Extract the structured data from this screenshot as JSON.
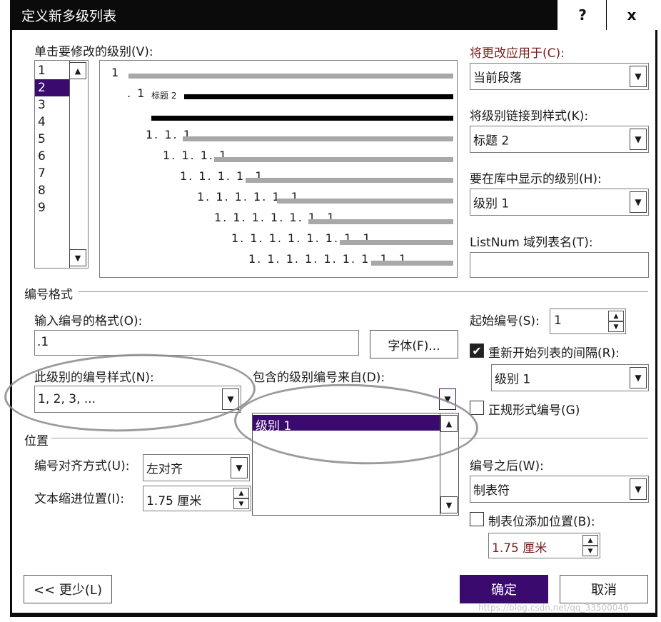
{
  "window": {
    "title": "定义新多级列表",
    "help_label": "?",
    "close_label": "x"
  },
  "levels": {
    "label": "单击要修改的级别(V):",
    "items": [
      "1",
      "2",
      "3",
      "4",
      "5",
      "6",
      "7",
      "8",
      "9"
    ],
    "selected": "2"
  },
  "preview": {
    "rows": [
      "1",
      ". 1",
      "1. 1. 1",
      "1. 1. 1. 1",
      "1. 1. 1. 1. 1",
      "1. 1. 1. 1. 1. 1",
      "1. 1. 1. 1. 1. 1. 1",
      "1. 1. 1. 1. 1. 1. 1. 1",
      "1. 1. 1. 1. 1. 1. 1. 1. 1"
    ],
    "heading_label": "标题 2"
  },
  "right": {
    "apply_label": "将更改应用于(C):",
    "apply_value": "当前段落",
    "link_label": "将级别链接到样式(K):",
    "link_value": "标题 2",
    "gallery_label": "要在库中显示的级别(H):",
    "gallery_value": "级别 1",
    "listnum_label": "ListNum 域列表名(T):",
    "listnum_value": ""
  },
  "number_format": {
    "section_label": "编号格式",
    "format_label": "输入编号的格式(O):",
    "format_value": ".1",
    "font_button": "字体(F)...",
    "style_label": "此级别的编号样式(N):",
    "style_value": "1, 2, 3, ...",
    "include_label": "包含的级别编号来自(D):",
    "include_dropdown_items": [
      "级别 1"
    ],
    "start_label": "起始编号(S):",
    "start_value": "1",
    "restart_label": "重新开始列表的间隔(R):",
    "restart_checked": true,
    "restart_value": "级别 1",
    "legal_label": "正规形式编号(G)",
    "legal_checked": false
  },
  "position": {
    "section_label": "位置",
    "align_label": "编号对齐方式(U):",
    "align_value": "左对齐",
    "indent_label": "文本缩进位置(I):",
    "indent_value": "1.75 厘米",
    "after_label": "编号之后(W):",
    "after_value": "制表符",
    "tab_label": "制表位添加位置(B):",
    "tab_checked": false,
    "tab_value": "1.75 厘米"
  },
  "buttons": {
    "less": "<< 更少(L)",
    "ok": "确定",
    "cancel": "取消"
  },
  "watermark": "https://blog.csdn.net/qq_33500046",
  "colors": {
    "accent": "#3b0a6e",
    "titlebar": "#0b0b0b",
    "label_red": "#7a1b1b"
  }
}
